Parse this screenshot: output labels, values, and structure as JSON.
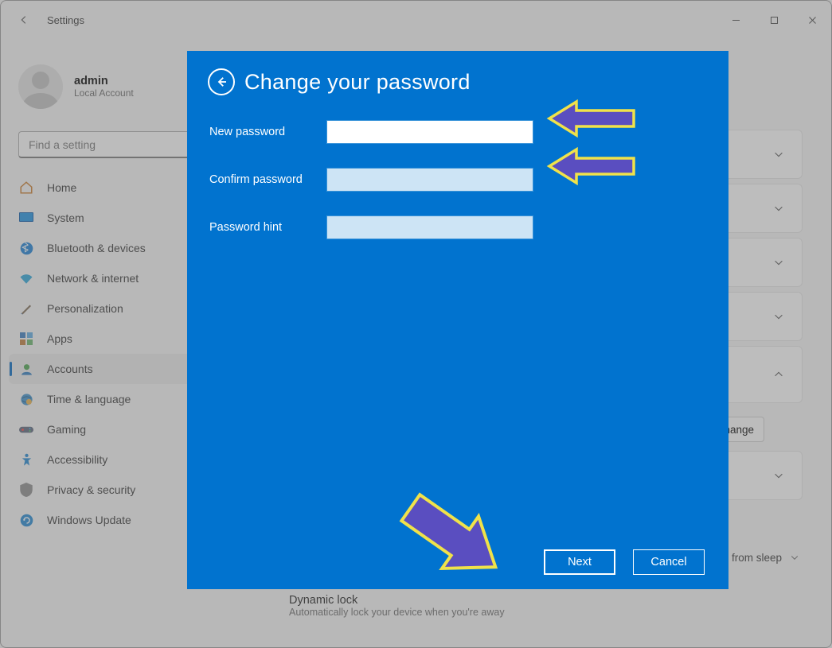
{
  "window": {
    "app_title": "Settings"
  },
  "profile": {
    "name": "admin",
    "subtitle": "Local Account"
  },
  "search": {
    "placeholder": "Find a setting"
  },
  "nav": [
    {
      "label": "Home"
    },
    {
      "label": "System"
    },
    {
      "label": "Bluetooth & devices"
    },
    {
      "label": "Network & internet"
    },
    {
      "label": "Personalization"
    },
    {
      "label": "Apps"
    },
    {
      "label": "Accounts",
      "active": true
    },
    {
      "label": "Time & language"
    },
    {
      "label": "Gaming"
    },
    {
      "label": "Accessibility"
    },
    {
      "label": "Privacy & security"
    },
    {
      "label": "Windows Update"
    }
  ],
  "main": {
    "change_button": "Change",
    "sleep_fragment": "from sleep",
    "dynamic_title": "Dynamic lock",
    "dynamic_sub": "Automatically lock your device when you're away"
  },
  "modal": {
    "title": "Change your password",
    "new_password_label": "New password",
    "confirm_password_label": "Confirm password",
    "hint_label": "Password hint",
    "next": "Next",
    "cancel": "Cancel"
  }
}
